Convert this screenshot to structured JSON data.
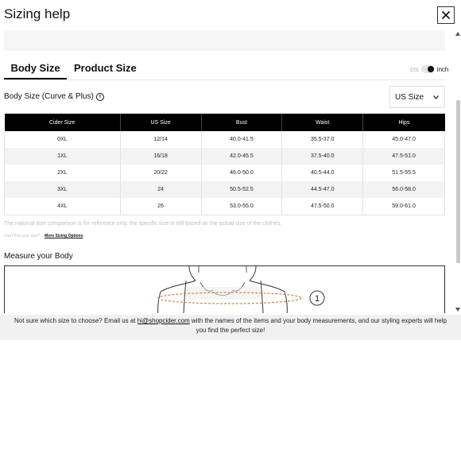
{
  "modal": {
    "title": "Sizing help"
  },
  "tabs": [
    {
      "label": "Body Size",
      "active": true
    },
    {
      "label": "Product Size",
      "active": false
    }
  ],
  "unit_toggle": {
    "cm_label": "cm",
    "inch_label": "inch",
    "selected": "inch"
  },
  "section": {
    "title": "Body Size (Curve & Plus)",
    "info_icon": "info-icon"
  },
  "region_select": {
    "value": "US Size"
  },
  "size_table": {
    "columns": [
      "Cider Size",
      "US Size",
      "Bust",
      "Waist",
      "Hips"
    ],
    "rows": [
      [
        "0XL",
        "12/14",
        "40.0-41.5",
        "35.5-37.0",
        "45.0-47.0"
      ],
      [
        "1XL",
        "16/18",
        "42.0-45.5",
        "37.5-40.0",
        "47.5-51.0"
      ],
      [
        "2XL",
        "20/22",
        "46.0-50.0",
        "40.5-44.0",
        "51.5-55.5"
      ],
      [
        "3XL",
        "24",
        "50.5-52.5",
        "44.5-47.0",
        "56.0-58.0"
      ],
      [
        "4XL",
        "26",
        "53.0-55.0",
        "47.5-50.0",
        "59.0-61.0"
      ]
    ]
  },
  "note": "The national size comparison is for reference only, the specific size is still based on the actual size of the clothes.",
  "cant_find": {
    "text": "Can't find your size?",
    "link": "More Sizing Options"
  },
  "measure": {
    "title": "Measure your Body",
    "marker": "1"
  },
  "footer": {
    "before": "Not sure which size to choose? Email us at ",
    "email": "hi@shopcider.com",
    "after": " with the names of the items and your body measurements, and our styling experts will help you find the perfect size!"
  },
  "colors": {
    "header_bg": "#000000",
    "stripe": "#f3f3f3",
    "measure_line": "#d9844a"
  }
}
